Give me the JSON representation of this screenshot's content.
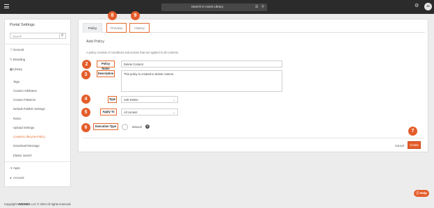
{
  "topbar": {
    "search_placeholder": "Search in Asset Library",
    "user_initials": "JD",
    "icons": {
      "menu": "hamburger-icon",
      "filter": "filter-icon",
      "search": "search-icon",
      "settings": "gear-icon"
    }
  },
  "sidebar": {
    "title": "Portal Settings",
    "search_placeholder": "Search",
    "top_items": [
      {
        "label": "General",
        "icon": "info-icon"
      },
      {
        "label": "Branding",
        "icon": "pencil-icon"
      },
      {
        "label": "Library",
        "icon": "library-icon"
      }
    ],
    "library_items": [
      "Tags",
      "Custom Attributes",
      "Custom Patterns",
      "Default Publish Settings",
      "Roles",
      "Upload Settings",
      "Content Lifecycle Policy",
      "Download Message",
      "Elastic search"
    ],
    "active_item": "Content Lifecycle Policy",
    "bottom_items": [
      {
        "label": "Apps",
        "icon": "arrow-icon"
      },
      {
        "label": "Account",
        "icon": "user-icon"
      }
    ]
  },
  "main": {
    "tabs": [
      {
        "label": "Policy"
      },
      {
        "label": "Preview"
      },
      {
        "label": "History"
      }
    ],
    "title": "Add Policy",
    "intro": "A policy consists of conditions and actions that are applied to all contents.",
    "form": {
      "policy_name_label": "Policy Name",
      "policy_name_value": "Delete Content",
      "description_label": "Description",
      "description_value": "This policy is created to delete content",
      "type_label": "Type",
      "type_value": "Soft Delete",
      "apply_to_label": "Apply To",
      "apply_to_value": "All content",
      "execution_type_label": "Execution Type",
      "execution_option": "Manual"
    },
    "buttons": {
      "cancel": "Cancel",
      "create": "Create"
    }
  },
  "markers": {
    "preview": "8",
    "history": "9",
    "policy_name": "2",
    "description": "3",
    "type": "4",
    "apply_to": "5",
    "execution_type": "6",
    "create": "7"
  },
  "footer": {
    "prefix": "Copyright",
    "brand": "VEEDMO",
    "text": "LLC © 2024 All rights reserved."
  },
  "help_button": "Help",
  "colors": {
    "accent": "#e45d2a",
    "topbar": "#2b2b2b",
    "active_link": "#e46a2c"
  }
}
